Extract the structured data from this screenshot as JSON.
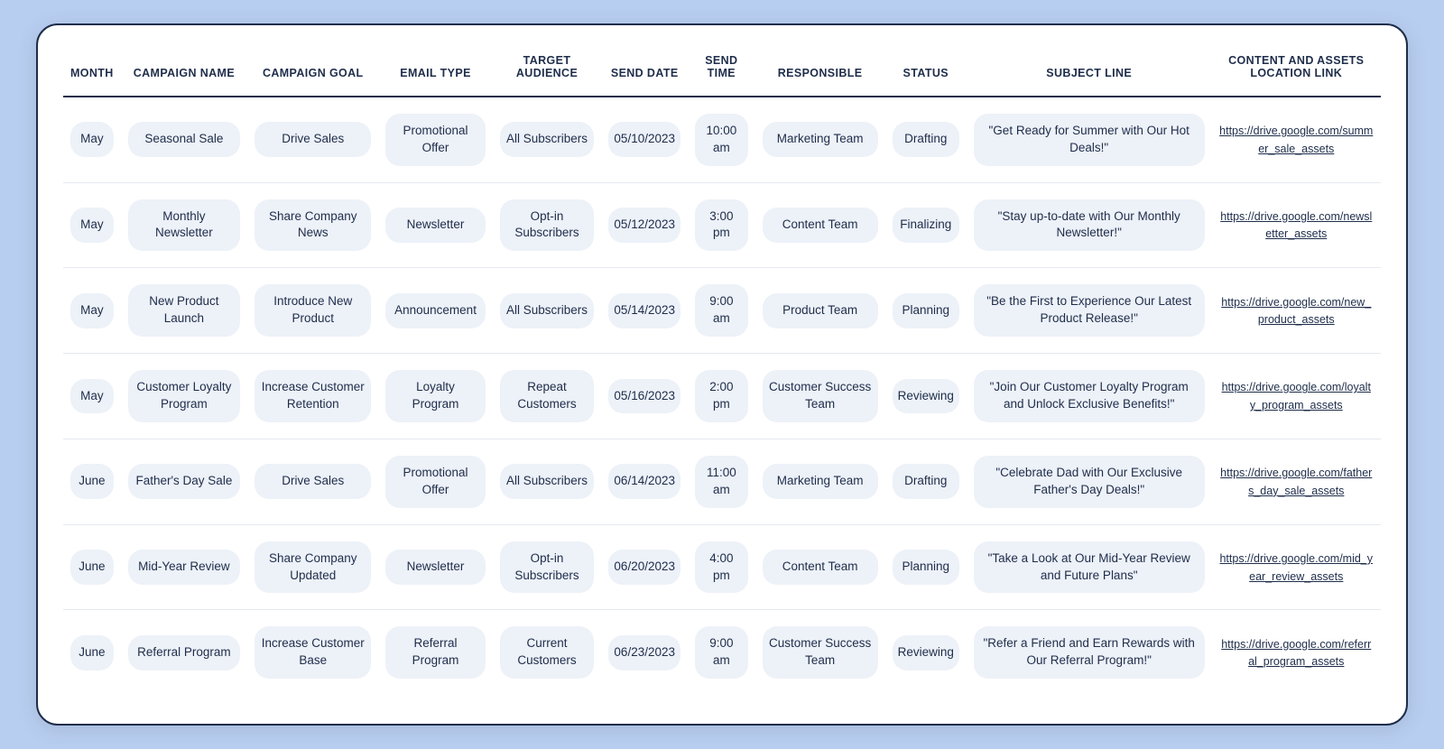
{
  "headers": [
    "MONTH",
    "CAMPAIGN NAME",
    "CAMPAIGN GOAL",
    "EMAIL TYPE",
    "TARGET AUDIENCE",
    "SEND DATE",
    "SEND TIME",
    "RESPONSIBLE",
    "STATUS",
    "SUBJECT LINE",
    "CONTENT AND ASSETS LOCATION LINK"
  ],
  "rows": [
    {
      "month": "May",
      "campaign_name": "Seasonal Sale",
      "campaign_goal": "Drive Sales",
      "email_type": "Promotional Offer",
      "target_audience": "All Subscribers",
      "send_date": "05/10/2023",
      "send_time": "10:00 am",
      "responsible": "Marketing Team",
      "status": "Drafting",
      "subject_line": "\"Get Ready for Summer with Our Hot Deals!\"",
      "content_link": "https://drive.google.com/summer_sale_assets"
    },
    {
      "month": "May",
      "campaign_name": "Monthly Newsletter",
      "campaign_goal": "Share Company News",
      "email_type": "Newsletter",
      "target_audience": "Opt-in Subscribers",
      "send_date": "05/12/2023",
      "send_time": "3:00 pm",
      "responsible": "Content Team",
      "status": "Finalizing",
      "subject_line": "\"Stay up-to-date with Our Monthly Newsletter!\"",
      "content_link": "https://drive.google.com/newsletter_assets"
    },
    {
      "month": "May",
      "campaign_name": "New Product Launch",
      "campaign_goal": "Introduce New Product",
      "email_type": "Announcement",
      "target_audience": "All Subscribers",
      "send_date": "05/14/2023",
      "send_time": "9:00 am",
      "responsible": "Product Team",
      "status": "Planning",
      "subject_line": "\"Be the First to Experience Our Latest Product Release!\"",
      "content_link": "https://drive.google.com/new_product_assets"
    },
    {
      "month": "May",
      "campaign_name": "Customer Loyalty Program",
      "campaign_goal": "Increase Customer Retention",
      "email_type": "Loyalty Program",
      "target_audience": "Repeat Customers",
      "send_date": "05/16/2023",
      "send_time": "2:00 pm",
      "responsible": "Customer Success Team",
      "status": "Reviewing",
      "subject_line": "\"Join Our Customer Loyalty Program and Unlock Exclusive Benefits!\"",
      "content_link": "https://drive.google.com/loyalty_program_assets"
    },
    {
      "month": "June",
      "campaign_name": "Father's Day Sale",
      "campaign_goal": "Drive Sales",
      "email_type": "Promotional Offer",
      "target_audience": "All Subscribers",
      "send_date": "06/14/2023",
      "send_time": "11:00 am",
      "responsible": "Marketing Team",
      "status": "Drafting",
      "subject_line": "\"Celebrate Dad with Our Exclusive Father's Day Deals!\"",
      "content_link": "https://drive.google.com/fathers_day_sale_assets"
    },
    {
      "month": "June",
      "campaign_name": "Mid-Year Review",
      "campaign_goal": "Share Company Updated",
      "email_type": "Newsletter",
      "target_audience": "Opt-in Subscribers",
      "send_date": "06/20/2023",
      "send_time": "4:00 pm",
      "responsible": "Content Team",
      "status": "Planning",
      "subject_line": "\"Take a Look at Our Mid-Year Review and Future Plans\"",
      "content_link": "https://drive.google.com/mid_year_review_assets"
    },
    {
      "month": "June",
      "campaign_name": "Referral Program",
      "campaign_goal": "Increase Customer Base",
      "email_type": "Referral Program",
      "target_audience": "Current Customers",
      "send_date": "06/23/2023",
      "send_time": "9:00 am",
      "responsible": "Customer Success Team",
      "status": "Reviewing",
      "subject_line": "\"Refer a Friend and Earn Rewards with Our Referral Program!\"",
      "content_link": "https://drive.google.com/referral_program_assets"
    }
  ]
}
